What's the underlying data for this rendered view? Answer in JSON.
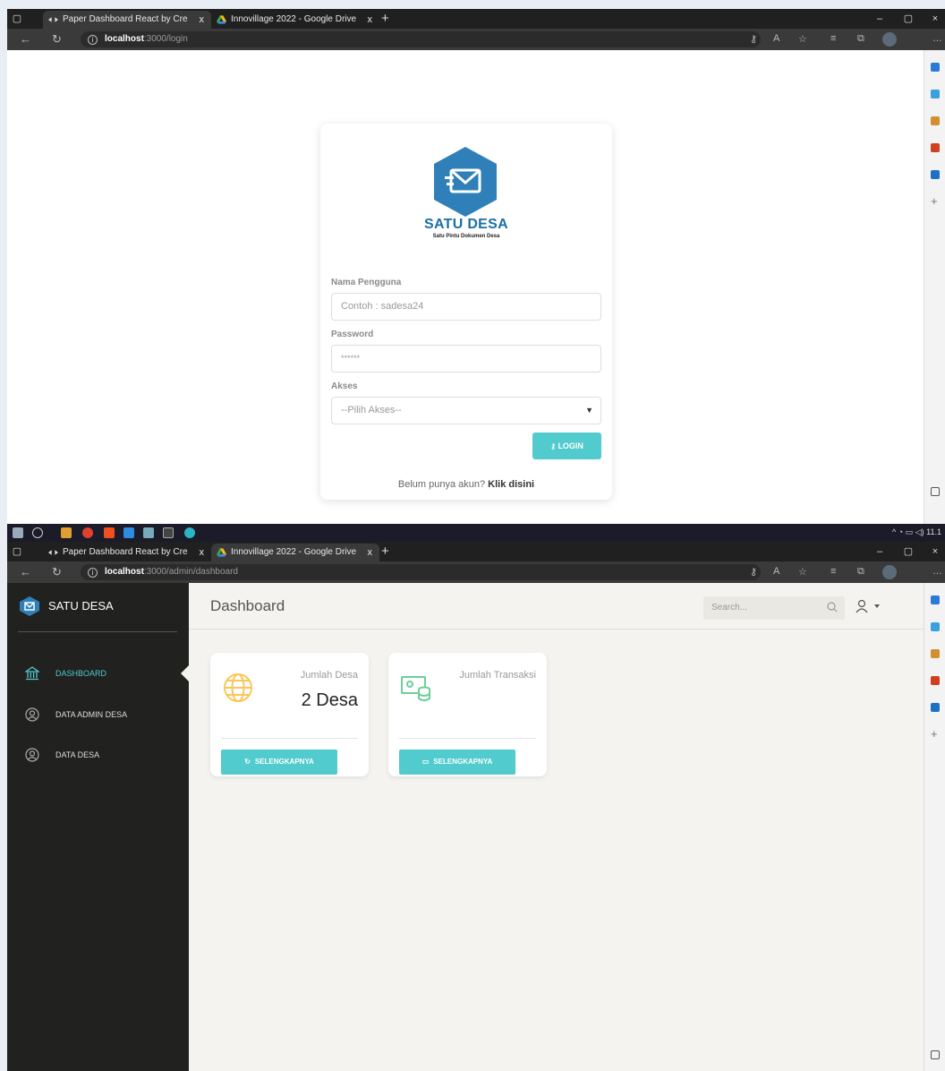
{
  "top_browser": {
    "tabs": [
      {
        "title": "Paper Dashboard React by Creati",
        "close": "x"
      },
      {
        "title": "Innovillage 2022 - Google Drive",
        "close": "x"
      }
    ],
    "new_tab": "+",
    "url_host": "localhost",
    "url_path": ":3000/login",
    "window_controls": [
      "–",
      "▢",
      "×"
    ]
  },
  "login": {
    "brand_name": "SATU DESA",
    "brand_tagline": "Satu Pintu Dokumen Desa",
    "username_label": "Nama Pengguna",
    "username_placeholder": "Contoh : sadesa24",
    "password_label": "Password",
    "password_value": "******",
    "akses_label": "Akses",
    "akses_selected": "--Pilih Akses--",
    "login_button": "LOGIN",
    "signup_text": "Belum punya akun?",
    "signup_link": "Klik disini",
    "accent": "#51cbce",
    "brand_color": "#2f80b8"
  },
  "taskbar": {
    "tray_text": "11.1"
  },
  "bottom_browser": {
    "tabs": [
      {
        "title": "Paper Dashboard React by Creati",
        "close": "x"
      },
      {
        "title": "Innovillage 2022 - Google Drive",
        "close": "x"
      }
    ],
    "new_tab": "+",
    "url_host": "localhost",
    "url_path": ":3000/admin/dashboard",
    "window_controls": [
      "–",
      "▢",
      "×"
    ]
  },
  "dashboard": {
    "sidebar_brand": "SATU DESA",
    "nav": [
      {
        "label": "DASHBOARD",
        "icon": "bank-icon",
        "active": true
      },
      {
        "label": "DATA ADMIN DESA",
        "icon": "user-circle-icon",
        "active": false
      },
      {
        "label": "DATA DESA",
        "icon": "user-circle-icon",
        "active": false
      }
    ],
    "page_title": "Dashboard",
    "search_placeholder": "Search...",
    "cards": [
      {
        "label": "Jumlah Desa",
        "value": "2 Desa",
        "button": "SELENGKAPNYA",
        "icon": "globe-icon",
        "icon_color": "#fbc658"
      },
      {
        "label": "Jumlah Transaksi",
        "value": "",
        "button": "SELENGKAPNYA",
        "icon": "money-coins-icon",
        "icon_color": "#6bd098"
      }
    ],
    "sidebar_bg": "#212120",
    "main_bg": "#f4f3ef"
  }
}
